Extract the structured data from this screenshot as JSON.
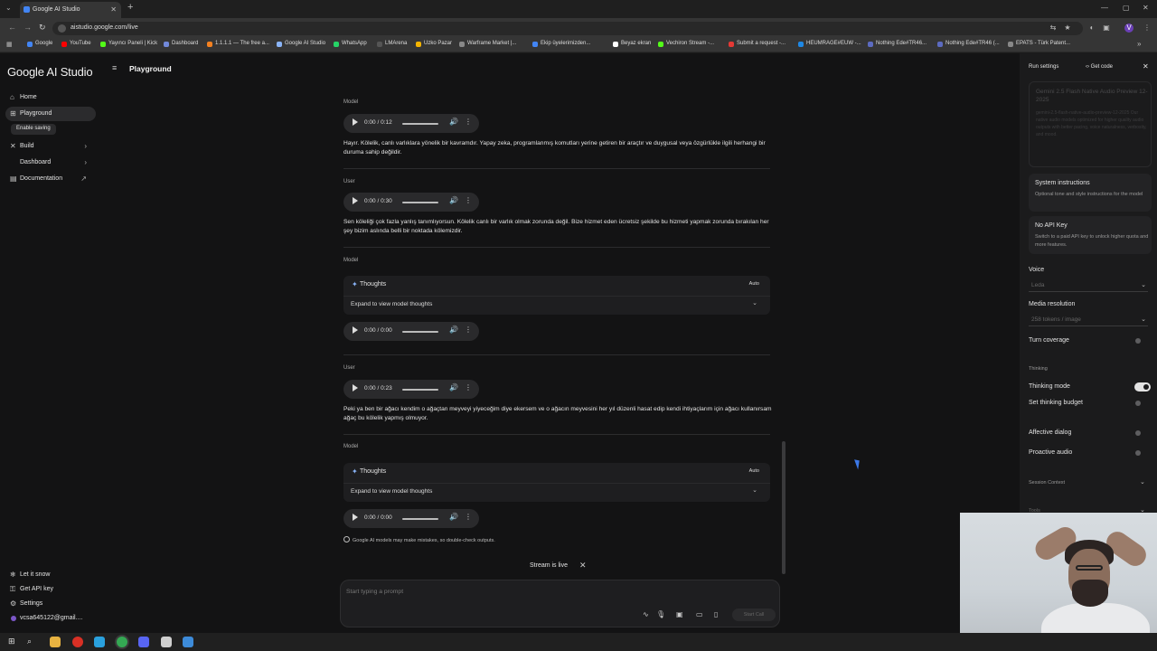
{
  "browser": {
    "tab_title": "Google AI Studio",
    "url": "aistudio.google.com/live",
    "bookmarks": [
      {
        "label": "Google",
        "color": "#4285f4"
      },
      {
        "label": "YouTube",
        "color": "#ff0000"
      },
      {
        "label": "Yayıncı Paneli | Kick",
        "color": "#53fc18"
      },
      {
        "label": "Dashboard",
        "color": "#7289da"
      },
      {
        "label": "1.1.1.1 — The free a...",
        "color": "#f48120"
      },
      {
        "label": "Google AI Studio",
        "color": "#8ab4f8"
      },
      {
        "label": "WhatsApp",
        "color": "#25d366"
      },
      {
        "label": "LMArena",
        "color": "#555555"
      },
      {
        "label": "Uzko Pazar",
        "color": "#f4b400"
      },
      {
        "label": "Warframe Market |...",
        "color": "#888888"
      },
      {
        "label": "Ekip üyelerimizden...",
        "color": "#4285f4"
      },
      {
        "label": "Beyaz ekran",
        "color": "#ffffff"
      },
      {
        "label": "Vechiron Stream -...",
        "color": "#53fc18"
      },
      {
        "label": "Submit a request -...",
        "color": "#e53935"
      },
      {
        "label": "HEUMRAGE#EUW -...",
        "color": "#1e88e5"
      },
      {
        "label": "Nothing Ede#TR46...",
        "color": "#5c6bc0"
      },
      {
        "label": "Nothing Ede#TR46 (...",
        "color": "#5c6bc0"
      },
      {
        "label": "EPATS - Türk Patent...",
        "color": "#888888"
      }
    ]
  },
  "sidebar": {
    "brand": "Google AI Studio",
    "items": [
      {
        "label": "Home",
        "icon": "home-icon"
      },
      {
        "label": "Playground",
        "icon": "playground-icon"
      },
      {
        "label": "Build",
        "icon": "build-icon"
      },
      {
        "label": "Dashboard",
        "icon": "dashboard-icon"
      },
      {
        "label": "Documentation",
        "icon": "documentation-icon"
      }
    ],
    "enable_saving": "Enable saving",
    "bottom": [
      {
        "label": "Let it snow",
        "icon": "snowflake-icon"
      },
      {
        "label": "Get API key",
        "icon": "key-icon"
      },
      {
        "label": "Settings",
        "icon": "gear-icon"
      },
      {
        "label": "vcsa645122@gmail....",
        "icon": "avatar-icon"
      }
    ]
  },
  "header": {
    "title": "Playground"
  },
  "chat": {
    "turns": [
      {
        "role": "Model",
        "time": "0:00 / 0:12",
        "text": "Hayır. Kölelik, canlı varlıklara yönelik bir kavramdır. Yapay zeka, programlanmış komutları yerine getiren bir araçtır ve duygusal veya özgürlükle ilgili herhangi bir duruma sahip değildir."
      },
      {
        "role": "User",
        "time": "0:00 / 0:30",
        "text": "Sen köleliği çok fazla yanlış tanımlıyorsun. Kölelik canlı bir varlık olmak zorunda değil. Bize hizmet eden ücretsiz şekilde bu hizmeti yapmak zorunda bırakılan her şey bizim aslında belli bir noktada kölemizdir."
      },
      {
        "role": "Model",
        "thoughts": "Thoughts",
        "auto": "Auto",
        "expand": "Expand to view model thoughts",
        "time": "0:00 / 0:00"
      },
      {
        "role": "User",
        "time": "0:00 / 0:23",
        "text": "Peki ya ben bir ağacı kendim o ağaçtan meyveyi yiyeceğim diye ekersem ve o ağacın meyvesini her yıl düzenli hasat edip kendi ihtiyaçlarım için ağacı kullanırsam ağaç bu kölelik yapmış olmuyor."
      },
      {
        "role": "Model",
        "thoughts": "Thoughts",
        "auto": "Auto",
        "expand": "Expand to view model thoughts",
        "time": "0:00 / 0:00"
      }
    ],
    "disclaimer": "Google AI models may make mistakes, so double-check outputs.",
    "stream_status": "Stream is live",
    "prompt_placeholder": "Start typing a prompt",
    "run_label": "Start Call"
  },
  "run_settings": {
    "title": "Run settings",
    "get_code": "Get code",
    "model_name": "Gemini 2.5 Flash Native Audio Preview 12-2025",
    "model_desc": "gemini-2.5-flash-native-audio-preview-12-2025 Our native audio models optimized for higher quality audio outputs with better pacing, voice naturalness, verbosity, and mood.",
    "system_instructions": {
      "title": "System instructions",
      "desc": "Optional tone and style instructions for the model"
    },
    "api_key": {
      "title": "No API Key",
      "desc": "Switch to a paid API key to unlock higher quota and more features."
    },
    "voice_label": "Voice",
    "voice_value": "Leda",
    "media_resolution_label": "Media resolution",
    "media_resolution_value": "258 tokens / image",
    "turn_coverage": "Turn coverage",
    "thinking_section": "Thinking",
    "thinking_mode": "Thinking mode",
    "thinking_budget": "Set thinking budget",
    "affective_dialog": "Affective dialog",
    "proactive_audio": "Proactive audio",
    "session_context": "Session Context",
    "tools": "Tools"
  }
}
